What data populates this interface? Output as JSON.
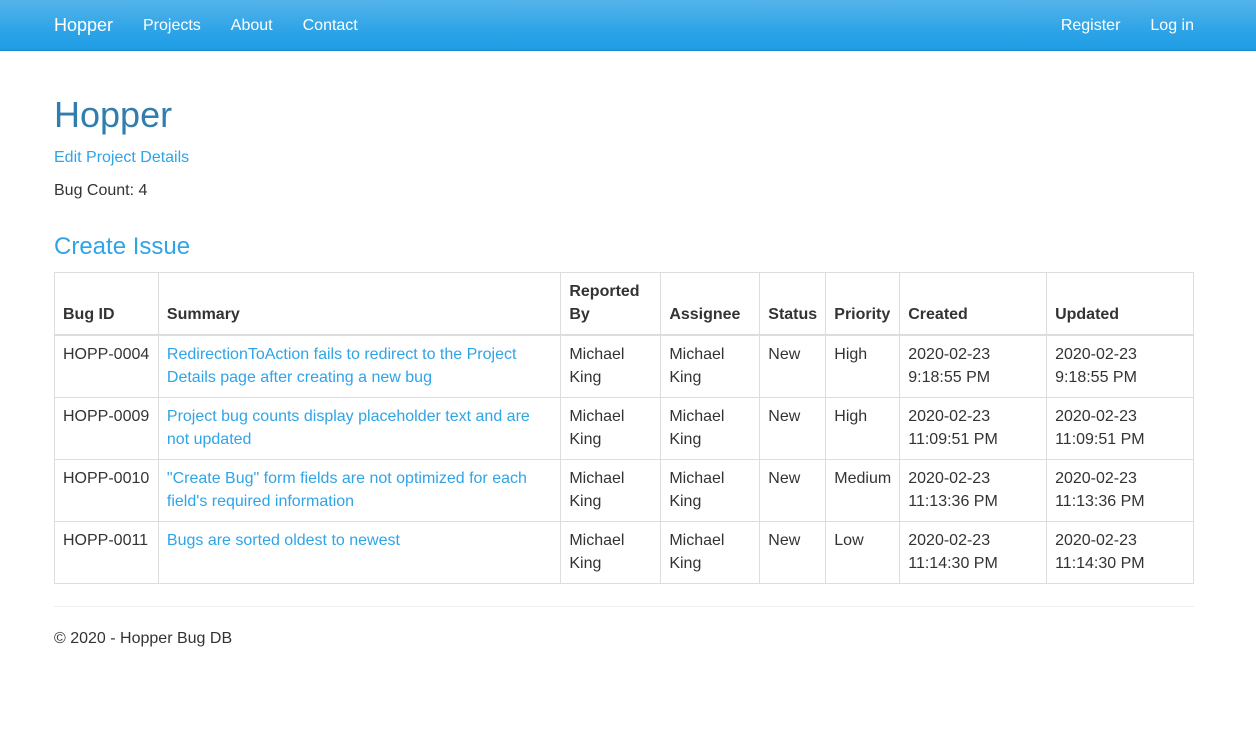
{
  "navbar": {
    "brand": "Hopper",
    "left_links": [
      "Projects",
      "About",
      "Contact"
    ],
    "right_links": [
      "Register",
      "Log in"
    ],
    "color": "#2fa4e7"
  },
  "project": {
    "title": "Hopper",
    "edit_link": "Edit Project Details",
    "bug_count_text": "Bug Count: 4"
  },
  "create_issue_label": "Create Issue",
  "table": {
    "headers": [
      "Bug ID",
      "Summary",
      "Reported By",
      "Assignee",
      "Status",
      "Priority",
      "Created",
      "Updated"
    ],
    "rows": [
      {
        "bug_id": "HOPP-0004",
        "summary": "RedirectionToAction fails to redirect to the Project Details page after creating a new bug",
        "reported_by": "Michael King",
        "assignee": "Michael King",
        "status": "New",
        "priority": "High",
        "created": "2020-02-23 9:18:55 PM",
        "updated": "2020-02-23 9:18:55 PM"
      },
      {
        "bug_id": "HOPP-0009",
        "summary": "Project bug counts display placeholder text and are not updated",
        "reported_by": "Michael King",
        "assignee": "Michael King",
        "status": "New",
        "priority": "High",
        "created": "2020-02-23 11:09:51 PM",
        "updated": "2020-02-23 11:09:51 PM"
      },
      {
        "bug_id": "HOPP-0010",
        "summary": "\"Create Bug\" form fields are not optimized for each field's required information",
        "reported_by": "Michael King",
        "assignee": "Michael King",
        "status": "New",
        "priority": "Medium",
        "created": "2020-02-23 11:13:36 PM",
        "updated": "2020-02-23 11:13:36 PM"
      },
      {
        "bug_id": "HOPP-0011",
        "summary": "Bugs are sorted oldest to newest",
        "reported_by": "Michael King",
        "assignee": "Michael King",
        "status": "New",
        "priority": "Low",
        "created": "2020-02-23 11:14:30 PM",
        "updated": "2020-02-23 11:14:30 PM"
      }
    ]
  },
  "footer": {
    "text": "© 2020 - Hopper Bug DB"
  }
}
